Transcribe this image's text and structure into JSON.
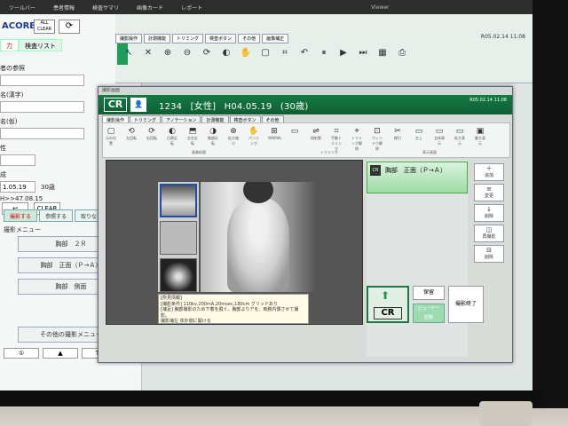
{
  "taskbar": {
    "items": [
      "ツールバー",
      "患者情報",
      "検査サマリ",
      "画像カード",
      "レポート"
    ],
    "title": "Viewer"
  },
  "left_panel": {
    "logo": "ACORE",
    "all_clear": "ALL CLEAR",
    "tabs": [
      "力",
      "検査リスト"
    ],
    "fields": [
      {
        "label": "者の参照",
        "value": ""
      },
      {
        "label": "名(漢字)",
        "value": ""
      },
      {
        "label": "名(仮)",
        "value": ""
      },
      {
        "label": "性",
        "value": ""
      },
      {
        "label": "成",
        "value": ""
      },
      {
        "label": "1.05.19",
        "value": "30歳"
      },
      {
        "label": "H>>47.08.15",
        "value": ""
      }
    ],
    "clear_label": "CLEAR",
    "enter_label": "↩",
    "tabs2": [
      "撮影する",
      "参照する",
      "取りなし"
    ],
    "menu_title": "撮影メニュー",
    "menu_items": [
      "胸部　２Ｒ",
      "胸部　正面（Ｐ→Ａ）",
      "胸部　側面"
    ],
    "other_menu": "その他の撮影メニュー",
    "footer": [
      "①",
      "▲",
      "TT"
    ]
  },
  "topbar": {
    "tabs": [
      "撮影操作",
      "計測機能",
      "トリミング",
      "検査ボタン",
      "その他",
      "画像補正"
    ],
    "time": "R05.02.14\n11:08"
  },
  "window": {
    "title": "撮影画面",
    "logo": "CR",
    "patient_id": "1234",
    "gender": "[女性]",
    "birth": "H04.05.19",
    "age": "(30歳)",
    "time": "R05.02.14\n11:08",
    "tabs": [
      "撮影操作",
      "トリミング",
      "アノテーション",
      "計測機能",
      "検査ボタン",
      "その他"
    ],
    "tools": [
      {
        "icon": "▢",
        "label": "元の位置"
      },
      {
        "icon": "⟲",
        "label": "左回転"
      },
      {
        "icon": "⟳",
        "label": "右回転"
      },
      {
        "icon": "◐",
        "label": "白黒反転"
      },
      {
        "icon": "⬒",
        "label": "左右反転"
      },
      {
        "icon": "◑",
        "label": "階調反転"
      },
      {
        "icon": "⊕",
        "label": "拡大縮小"
      },
      {
        "icon": "✋",
        "label": "パンニング"
      },
      {
        "icon": "⊞",
        "label": "WW/WL"
      },
      {
        "icon": "▭",
        "label": ""
      },
      {
        "icon": "⇌",
        "label": "照射野"
      },
      {
        "icon": "⌗",
        "label": "手動トリミング"
      },
      {
        "icon": "⌖",
        "label": "トリミング解除"
      },
      {
        "icon": "⊡",
        "label": "ウィンドウ解除"
      },
      {
        "icon": "✂",
        "label": "線引"
      },
      {
        "icon": "▭",
        "label": "左上"
      },
      {
        "icon": "▭",
        "label": "全体表示"
      },
      {
        "icon": "▭",
        "label": "拡大表示"
      },
      {
        "icon": "▣",
        "label": "最大表示"
      }
    ],
    "group_labels": [
      "画像処理",
      "トリミング",
      "表示画面"
    ],
    "findings": "[所見情報]\n[撮影条件] 110kv,200mA,20msec,180cm グリッドあり\n[補足] 胸部撮影のため下着を脱ぐ。胸部よりアを、両腕内側させて撮影。\n撮影補左 体外側に開ける\n[注意]事項 患者側確認要"
  },
  "exam": {
    "label": "胸部　正面（Ｐ→Ａ）"
  },
  "side_buttons": [
    {
      "icon": "＋",
      "label": "追加"
    },
    {
      "icon": "≡",
      "label": "変更"
    },
    {
      "icon": "↓",
      "label": "削除"
    },
    {
      "icon": "◫",
      "label": "再撮影"
    },
    {
      "icon": "⊟",
      "label": "削除"
    }
  ],
  "actions": {
    "cr_label": "CR",
    "hold": "保留",
    "viewer": "ビューアー\n起動",
    "done": "撮影終了"
  }
}
